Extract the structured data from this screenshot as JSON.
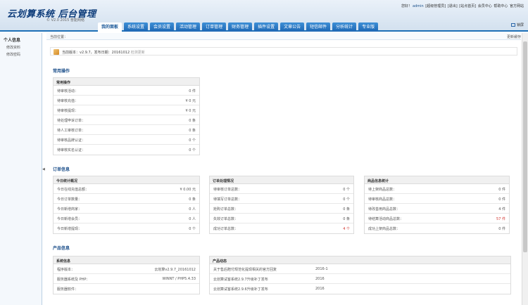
{
  "header": {
    "app_title": "云划算系统 后台管理",
    "subtitle": "© V2.0 2015 普能网络",
    "top_links": {
      "greeting": "您好！",
      "username": "admin",
      "profile": "[超级管理员]",
      "logout": "[退出]",
      "home": "[站点首页]",
      "member_center": "会员中心",
      "help_center": "帮助中心",
      "official": "官方网站"
    },
    "logout_label": "锁屏"
  },
  "nav": {
    "tabs": [
      "我的面板",
      "系统设置",
      "会员设置",
      "活动管理",
      "订单管理",
      "财务管理",
      "插件设置",
      "文章公告",
      "短信邮件",
      "分析统计",
      "专业版"
    ],
    "active_index": 0
  },
  "sidebar": {
    "title": "个人信息",
    "items": [
      "修改资料",
      "修改密码"
    ]
  },
  "breadcrumb": "当前位置：",
  "update_cache": "更新缓存",
  "version": {
    "text": "当前版本：v2.9.7，发布日期：20161012",
    "link": "检测更新"
  },
  "sections": {
    "common": "常用操作",
    "orders": "订单信息",
    "products": "产品信息"
  },
  "panels": {
    "common": {
      "title": "常用操作",
      "rows": [
        {
          "label": "待审核活动：",
          "value": "0 件"
        },
        {
          "label": "待审核充值：",
          "value": "¥ 0 元"
        },
        {
          "label": "待审核提现：",
          "value": "¥ 0 元"
        },
        {
          "label": "待处理申诉订单：",
          "value": "0 条"
        },
        {
          "label": "待人工审核订单：",
          "value": "0 条"
        },
        {
          "label": "待审核品牌认证：",
          "value": "0 个"
        },
        {
          "label": "待审核实名认证：",
          "value": "0 个"
        }
      ]
    },
    "today": {
      "title": "今日统计概况",
      "rows": [
        {
          "label": "今日在线充值总额：",
          "value": "¥ 0.00 元"
        },
        {
          "label": "今日订单数量：",
          "value": "0 条"
        },
        {
          "label": "今日新增商家：",
          "value": "0 人"
        },
        {
          "label": "今日新增会员：",
          "value": "0 人"
        },
        {
          "label": "今日新增提现：",
          "value": "0 个"
        }
      ]
    },
    "orders": {
      "title": "订单处理情况",
      "rows": [
        {
          "label": "待审核订单总数：",
          "value": "0 个"
        },
        {
          "label": "待填写订单总数：",
          "value": "0 个"
        },
        {
          "label": "抢购订单总数：",
          "value": "0 条"
        },
        {
          "label": "失效订单总数：",
          "value": "0 条"
        },
        {
          "label": "成功订单总数：",
          "value": "4 个",
          "red": true
        }
      ]
    },
    "goods": {
      "title": "商品信息统计",
      "rows": [
        {
          "label": "待上架商品总数：",
          "value": "0 件"
        },
        {
          "label": "待审核商品总数：",
          "value": "0 件"
        },
        {
          "label": "待改善用商品总数：",
          "value": "4 件"
        },
        {
          "label": "待结算活动商品总数：",
          "value": "57 件",
          "red": true
        },
        {
          "label": "成功上架商品总数：",
          "value": "0 件"
        }
      ]
    },
    "sys": {
      "title": "系统信息",
      "rows": [
        {
          "label": "程序版本：",
          "value": "云划算v2.9.7_20161012"
        },
        {
          "label": "服务器系统及 PHP：",
          "value": "WINNT / PHP5.4.33"
        },
        {
          "label": "服务器软件：",
          "value": ""
        }
      ]
    },
    "news": {
      "title": "产品动态",
      "rows": [
        {
          "label": "关于售后赔付规范化提现相关的官方回复",
          "date": "2016-1"
        },
        {
          "label": "云划算试客系统2.9.7升级补丁发布",
          "date": "2016"
        },
        {
          "label": "云划算试客系统2.9.6升级补丁发布",
          "date": "2016"
        }
      ]
    }
  }
}
